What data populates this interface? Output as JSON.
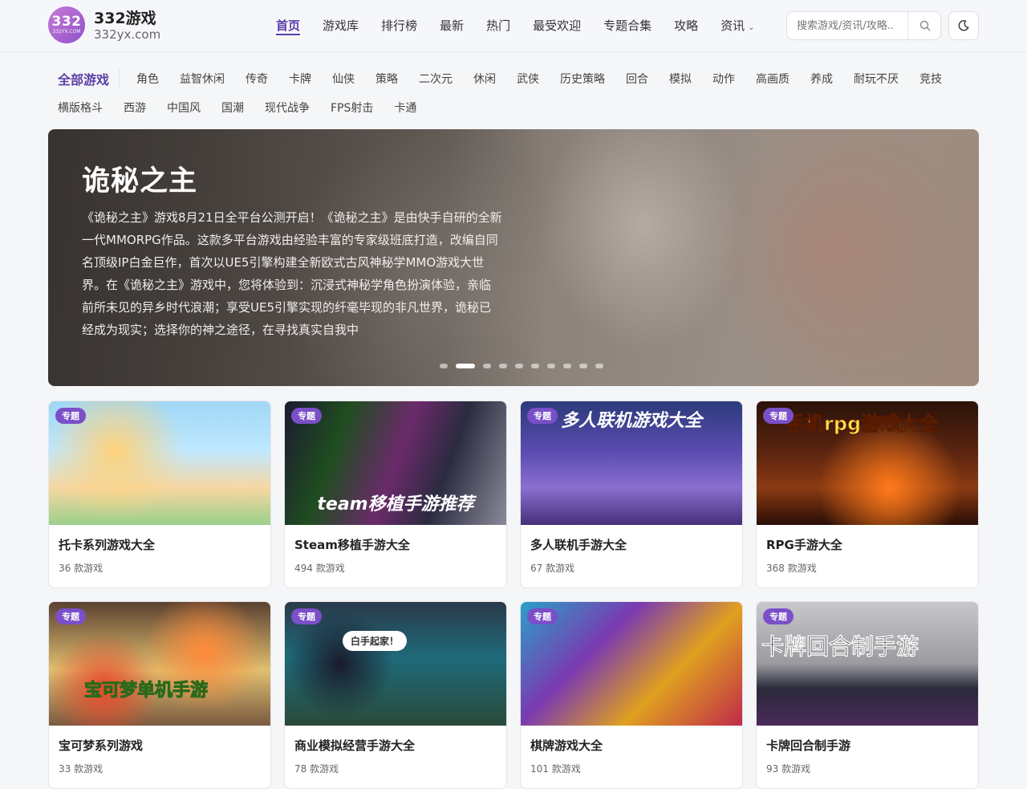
{
  "brand": {
    "logo_number": "332",
    "logo_sub": "332YX.COM",
    "name": "332游戏",
    "domain": "332yx.com",
    "accent_color": "#5b3ea8"
  },
  "nav": {
    "items": [
      "首页",
      "游戏库",
      "排行榜",
      "最新",
      "热门",
      "最受欢迎",
      "专题合集",
      "攻略",
      "资讯"
    ],
    "active_index": 0
  },
  "search": {
    "placeholder": "搜索游戏/资讯/攻略..",
    "icon": "search-icon"
  },
  "theme_toggle": {
    "icon": "moon-icon"
  },
  "categories": {
    "all_label": "全部游戏",
    "row1": [
      "角色",
      "益智休闲",
      "传奇",
      "卡牌",
      "仙侠",
      "策略",
      "二次元",
      "休闲",
      "武侠",
      "历史策略",
      "回合",
      "模拟",
      "动作",
      "高画质",
      "养成",
      "耐玩不厌",
      "竞技"
    ],
    "row2": [
      "横版格斗",
      "西游",
      "中国风",
      "国潮",
      "现代战争",
      "FPS射击",
      "卡通"
    ]
  },
  "hero": {
    "title": "诡秘之主",
    "description": "《诡秘之主》游戏8月21日全平台公测开启！《诡秘之主》是由快手自研的全新一代MMORPG作品。这款多平台游戏由经验丰富的专家级班底打造，改编自同名顶级IP白金巨作，首次以UE5引擎构建全新欧式古风神秘学MMO游戏大世界。在《诡秘之主》游戏中，您将体验到：沉浸式神秘学角色扮演体验，亲临前所未见的异乡时代浪潮；享受UE5引擎实现的纤毫毕现的非凡世界，诡秘已经成为现实；选择你的神之途径，在寻找真实自我中",
    "slide_count": 10,
    "active_slide": 1
  },
  "cards": [
    {
      "tag": "专题",
      "title": "托卡系列游戏大全",
      "count": "36 款游戏",
      "thumb_text": ""
    },
    {
      "tag": "专题",
      "title": "Steam移植手游大全",
      "count": "494 款游戏",
      "thumb_text": "team移植手游推荐"
    },
    {
      "tag": "专题",
      "title": "多人联机手游大全",
      "count": "67 款游戏",
      "thumb_text": "多人联机游戏大全"
    },
    {
      "tag": "专题",
      "title": "RPG手游大全",
      "count": "368 款游戏",
      "thumb_text": "手机rpg游戏大全"
    },
    {
      "tag": "专题",
      "title": "宝可梦系列游戏",
      "count": "33 款游戏",
      "thumb_text": "宝可梦单机手游"
    },
    {
      "tag": "专题",
      "title": "商业模拟经营手游大全",
      "count": "78 款游戏",
      "thumb_text": "白手起家！"
    },
    {
      "tag": "专题",
      "title": "棋牌游戏大全",
      "count": "101 款游戏",
      "thumb_text": ""
    },
    {
      "tag": "专题",
      "title": "卡牌回合制手游",
      "count": "93 款游戏",
      "thumb_text": "卡牌回合制手游"
    }
  ]
}
